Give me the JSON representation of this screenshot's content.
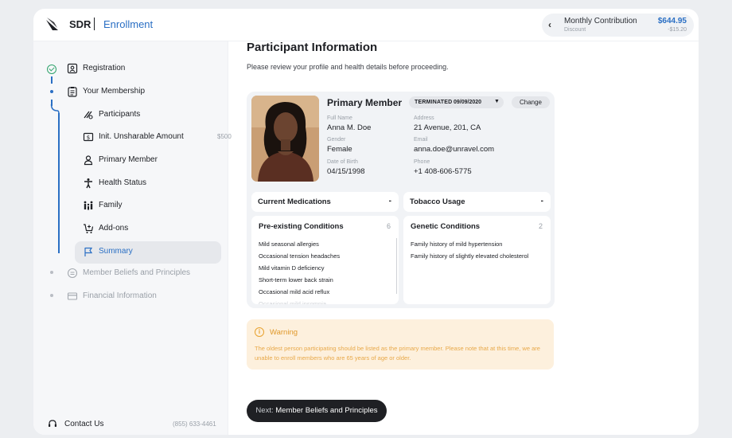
{
  "header": {
    "brand": "SDR",
    "section": "Enrollment",
    "contribution": {
      "title": "Monthly Contribution",
      "subtitle": "Discount",
      "amount": "$644.95",
      "discount": "-$15.20"
    }
  },
  "sidebar": {
    "items": [
      {
        "label": "Registration"
      },
      {
        "label": "Your Membership"
      },
      {
        "label": "Participants"
      },
      {
        "label": "Init. Unsharable Amount",
        "amount": "$500"
      },
      {
        "label": "Primary Member"
      },
      {
        "label": "Health Status"
      },
      {
        "label": "Family"
      },
      {
        "label": "Add-ons"
      },
      {
        "label": "Summary"
      },
      {
        "label": "Member Beliefs and Principles"
      },
      {
        "label": "Financial Information"
      }
    ],
    "contact": {
      "label": "Contact Us",
      "phone": "(855) 633-4461"
    },
    "colors": {
      "accent": "#2a6fc4",
      "done": "#2fa36b"
    }
  },
  "main": {
    "title": "Participant Information",
    "subtitle": "Please review your profile and health details before proceeding.",
    "member": {
      "heading": "Primary Member",
      "status": "TERMINATED",
      "status_date": "09/09/2020",
      "change_label": "Change",
      "fields": {
        "full_name_label": "Full Name",
        "full_name": "Anna M. Doe",
        "gender_label": "Gender",
        "gender": "Female",
        "dob_label": "Date of Birth",
        "dob": "04/15/1998",
        "address_label": "Address",
        "address": "21 Avenue, 201, CA",
        "email_label": "Email",
        "email": "anna.doe@unravel.com",
        "phone_label": "Phone",
        "phone": "+1 408-606-5775"
      }
    },
    "medications": {
      "title": "Current Medications",
      "value": "-"
    },
    "tobacco": {
      "title": "Tobacco Usage",
      "value": "-"
    },
    "preexisting": {
      "title": "Pre-existing Conditions",
      "count": "6",
      "items": [
        "Mild seasonal allergies",
        "Occasional tension headaches",
        "Mild vitamin D deficiency",
        "Short-term lower back strain",
        "Occasional mild acid reflux",
        "Occasional mild insomnia"
      ]
    },
    "genetic": {
      "title": "Genetic Conditions",
      "count": "2",
      "items": [
        "Family history of mild hypertension",
        "Family history of slightly elevated cholesterol"
      ]
    },
    "warning": {
      "title": "Warning",
      "message": "The oldest person participating should be listed as the primary member. Please note that at this time, we are unable to enroll members who are 65 years of age or older."
    },
    "next_button": {
      "prefix": "Next:",
      "label": "Member Beliefs and Principles"
    }
  }
}
